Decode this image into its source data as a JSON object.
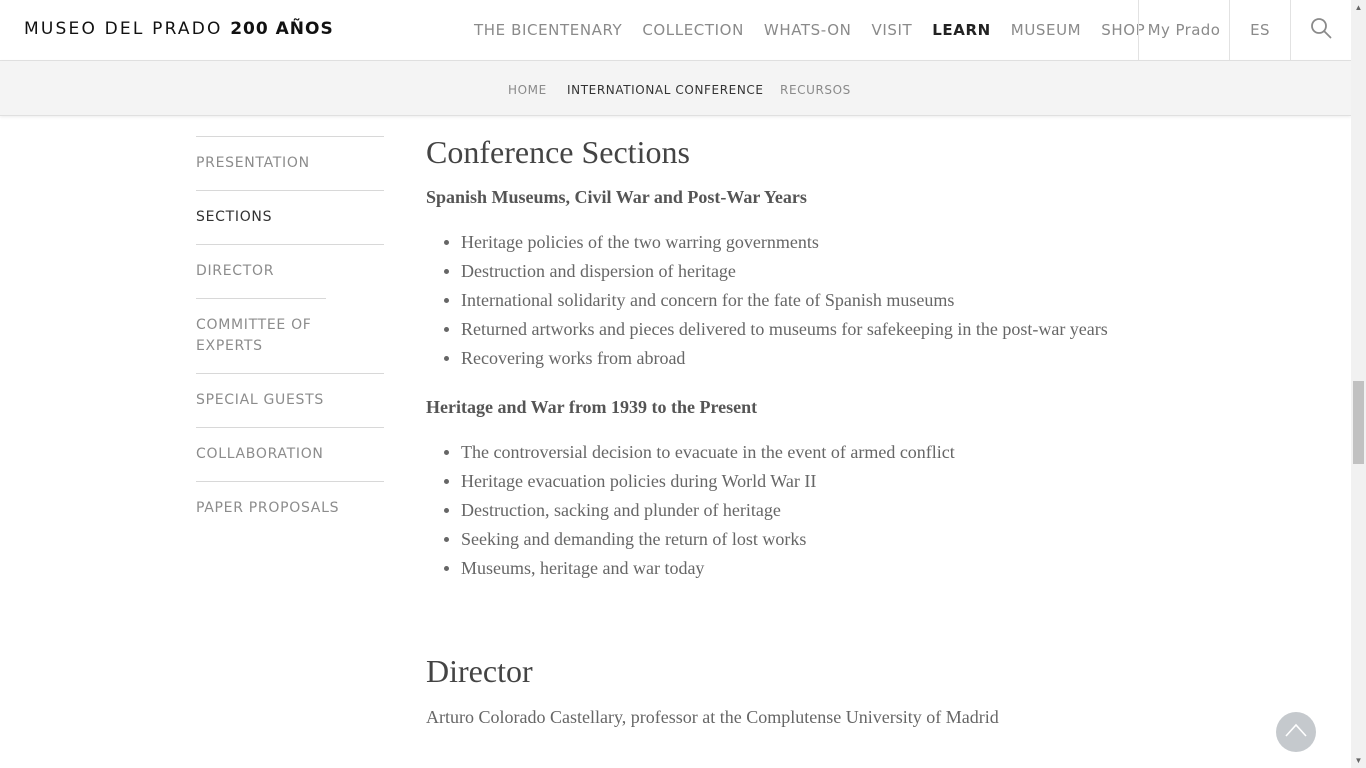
{
  "header": {
    "brand_main": "MUSEO DEL PRADO",
    "brand_bold": "200 AÑOS",
    "nav": [
      {
        "label": "THE BICENTENARY",
        "active": false
      },
      {
        "label": "COLLECTION",
        "active": false
      },
      {
        "label": "WHATS-ON",
        "active": false
      },
      {
        "label": "VISIT",
        "active": false
      },
      {
        "label": "LEARN",
        "active": true
      },
      {
        "label": "MUSEUM",
        "active": false
      },
      {
        "label": "SHOP",
        "active": false
      }
    ],
    "my_prado": "My Prado",
    "language": "ES",
    "search_icon": "search-icon"
  },
  "subnav": {
    "items": [
      {
        "label": "HOME",
        "active": false
      },
      {
        "label": "INTERNATIONAL CONFERENCE",
        "active": true
      },
      {
        "label": "RECURSOS",
        "active": false
      }
    ]
  },
  "sidebar": {
    "items": [
      {
        "label": "PRESENTATION",
        "active": false
      },
      {
        "label": "SECTIONS",
        "active": true
      },
      {
        "label": "DIRECTOR",
        "active": false
      },
      {
        "label": "COMMITTEE OF EXPERTS",
        "active": false
      },
      {
        "label": "SPECIAL GUESTS",
        "active": false
      },
      {
        "label": "COLLABORATION",
        "active": false
      },
      {
        "label": "PAPER PROPOSALS",
        "active": false
      }
    ]
  },
  "main": {
    "title": "Conference Sections",
    "sections": [
      {
        "heading": "Spanish Museums, Civil War and Post-War Years",
        "items": [
          "Heritage policies of the two warring governments",
          "Destruction and dispersion of heritage",
          "International solidarity and concern for the fate of Spanish museums",
          "Returned artworks and pieces delivered to museums for safekeeping in the post-war years",
          "Recovering works from abroad"
        ]
      },
      {
        "heading": "Heritage and War from 1939 to the Present",
        "items": [
          "The controversial decision to evacuate in the event of armed conflict",
          "Heritage evacuation policies during World War II",
          "Destruction, sacking and plunder of heritage",
          "Seeking and demanding the return of lost works",
          "Museums, heritage and war today"
        ]
      }
    ],
    "director_title": "Director",
    "director_text": "Arturo Colorado Castellary, professor at the Complutense University of Madrid"
  },
  "back_to_top_icon": "chevron-up-icon"
}
